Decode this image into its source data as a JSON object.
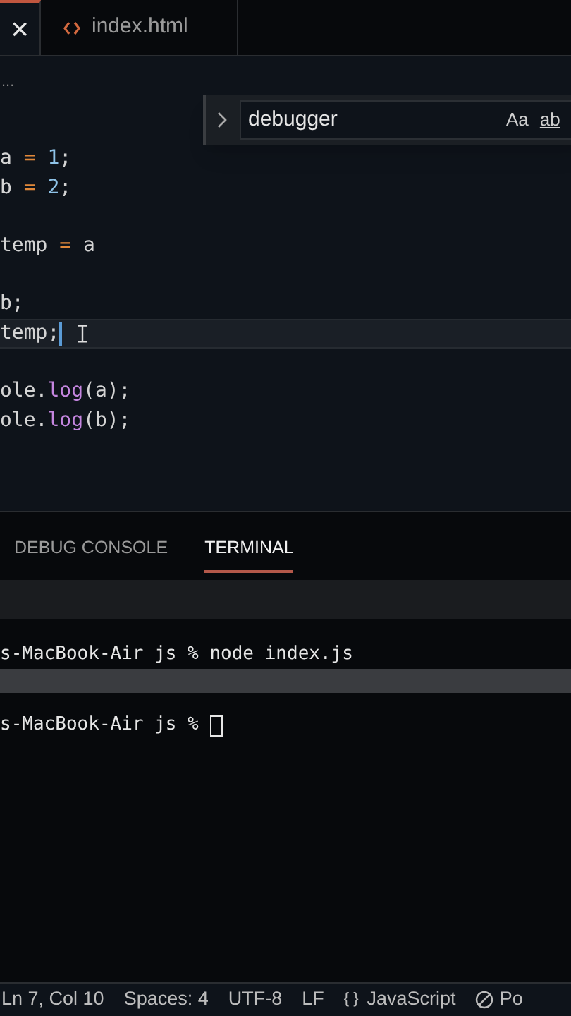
{
  "tabs": [
    {
      "close": "×",
      "selected": true
    },
    {
      "label": "index.html",
      "selected": false
    }
  ],
  "breadcrumb": "...",
  "find": {
    "value": "debugger",
    "options": [
      "Aa",
      "ab"
    ]
  },
  "code": [
    {
      "current": false,
      "tokens": [
        {
          "kind": "text",
          "text": "a "
        },
        {
          "kind": "op",
          "text": "="
        },
        {
          "kind": "num",
          "text": " 1"
        },
        {
          "kind": "text",
          "text": ";"
        }
      ]
    },
    {
      "current": false,
      "tokens": [
        {
          "kind": "text",
          "text": "b "
        },
        {
          "kind": "op",
          "text": "="
        },
        {
          "kind": "num",
          "text": " 2"
        },
        {
          "kind": "text",
          "text": ";"
        }
      ]
    },
    {
      "current": false
    },
    {
      "current": false,
      "tokens": [
        {
          "kind": "text",
          "text": "temp "
        },
        {
          "kind": "op",
          "text": "="
        },
        {
          "kind": "text",
          "text": " a"
        }
      ]
    },
    {
      "current": false
    },
    {
      "current": false,
      "tokens": [
        {
          "kind": "text",
          "text": "b;"
        }
      ]
    },
    {
      "current": true,
      "tokens": [
        {
          "kind": "text",
          "text": "temp;"
        }
      ]
    },
    {
      "current": false
    },
    {
      "current": false,
      "tokens": [
        {
          "kind": "text",
          "text": "ole."
        },
        {
          "kind": "fn",
          "text": "log"
        },
        {
          "kind": "text",
          "text": "(a);"
        }
      ]
    },
    {
      "current": false,
      "tokens": [
        {
          "kind": "text",
          "text": "ole."
        },
        {
          "kind": "fn",
          "text": "log"
        },
        {
          "kind": "text",
          "text": "(b);"
        }
      ]
    }
  ],
  "panel_tabs": [
    {
      "label": "DEBUG CONSOLE",
      "selected": false
    },
    {
      "label": "TERMINAL",
      "selected": true
    }
  ],
  "terminal": [
    {
      "text": "s-MacBook-Air js % node index.js",
      "cursor": false
    },
    {
      "text": "s-MacBook-Air js % ",
      "cursor": true
    }
  ],
  "status_bar": [
    {
      "kind": "text",
      "text": "Ln 7, Col 10"
    },
    {
      "kind": "text",
      "text": "Spaces: 4"
    },
    {
      "kind": "text",
      "text": "UTF-8"
    },
    {
      "kind": "text",
      "text": "LF"
    },
    {
      "kind": "braces",
      "icon": "{ }",
      "text": "JavaScript"
    },
    {
      "kind": "blocked",
      "text": "Po"
    }
  ]
}
